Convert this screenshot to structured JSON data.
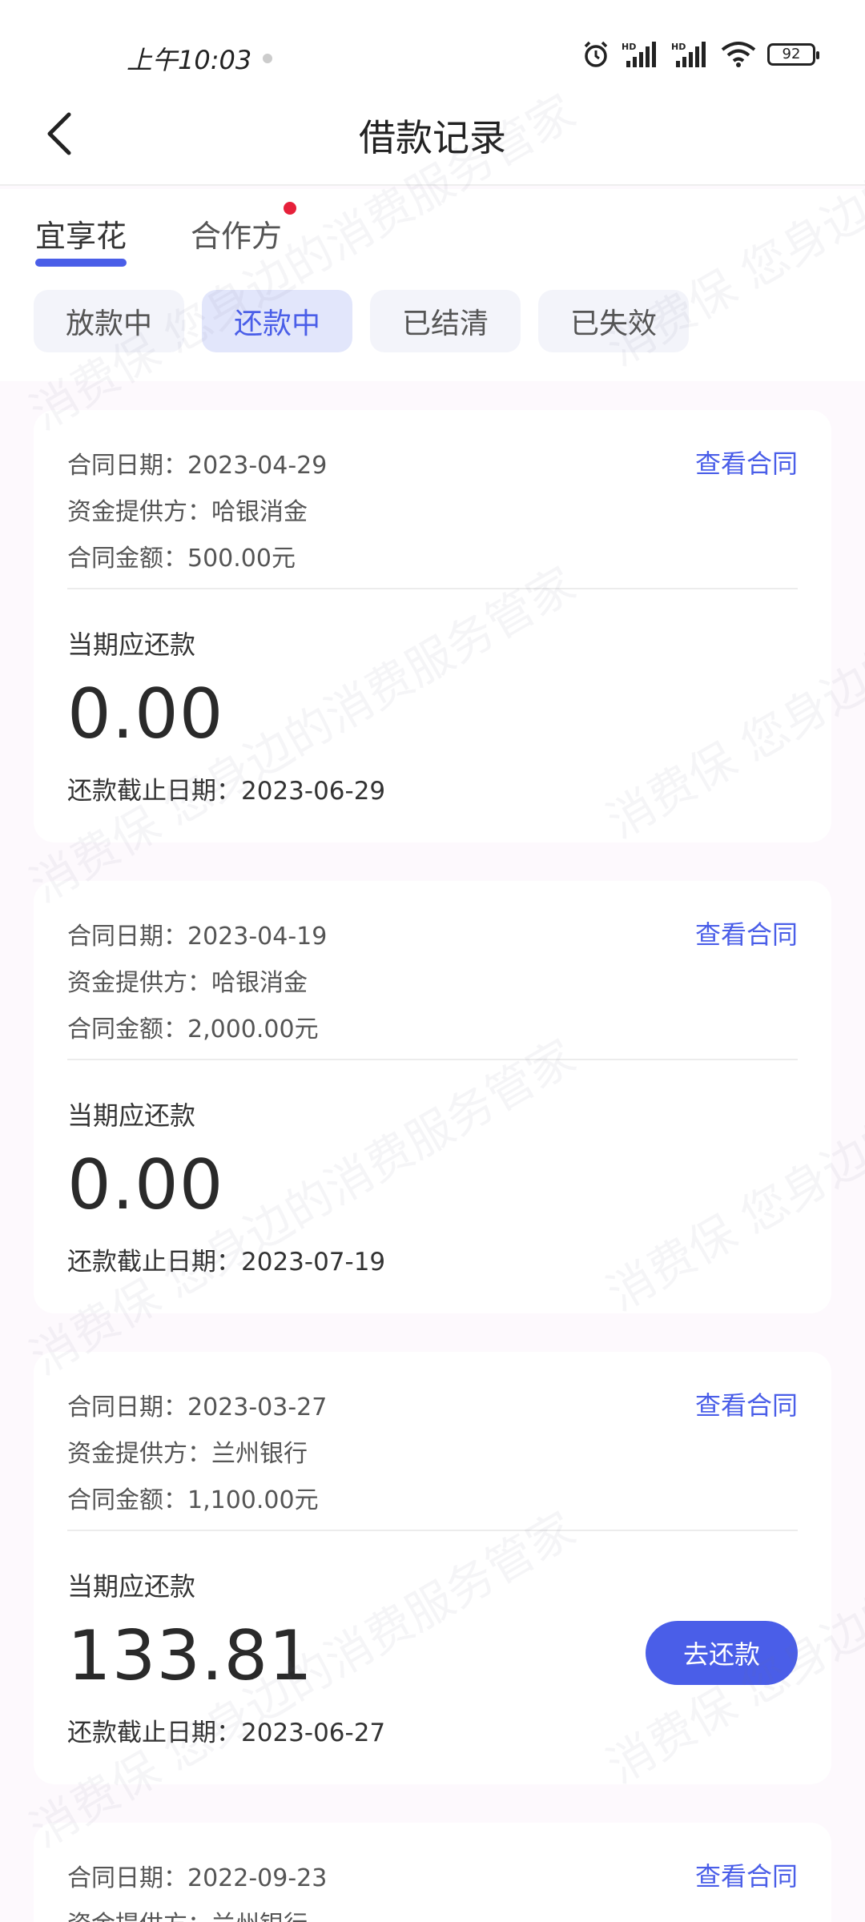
{
  "status_bar": {
    "time": "上午10:03",
    "battery": "92"
  },
  "nav": {
    "title": "借款记录"
  },
  "tabs": [
    {
      "label": "宜享花",
      "active": true
    },
    {
      "label": "合作方",
      "active": false,
      "badge": true
    }
  ],
  "filters": [
    {
      "label": "放款中",
      "active": false
    },
    {
      "label": "还款中",
      "active": true
    },
    {
      "label": "已结清",
      "active": false
    },
    {
      "label": "已失效",
      "active": false
    }
  ],
  "cards": [
    {
      "contract_date": "合同日期：2023-04-29",
      "provider": "资金提供方：哈银消金",
      "contract_amount": "合同金额：500.00元",
      "view_contract": "查看合同",
      "due_label": "当期应还款",
      "due_amount": "0.00",
      "deadline": "还款截止日期：2023-06-29"
    },
    {
      "contract_date": "合同日期：2023-04-19",
      "provider": "资金提供方：哈银消金",
      "contract_amount": "合同金额：2,000.00元",
      "view_contract": "查看合同",
      "due_label": "当期应还款",
      "due_amount": "0.00",
      "deadline": "还款截止日期：2023-07-19"
    },
    {
      "contract_date": "合同日期：2023-03-27",
      "provider": "资金提供方：兰州银行",
      "contract_amount": "合同金额：1,100.00元",
      "view_contract": "查看合同",
      "due_label": "当期应还款",
      "due_amount": "133.81",
      "deadline": "还款截止日期：2023-06-27",
      "repay_label": "去还款"
    },
    {
      "contract_date": "合同日期：2022-09-23",
      "provider": "资金提供方：兰州银行",
      "view_contract": "查看合同"
    }
  ],
  "watermark_text": "消费保 您身边的消费服务管家",
  "colors": {
    "accent": "#4a5ee8",
    "badge": "#e6203a",
    "chip_bg": "#f3f4fa",
    "chip_active_bg": "#e2e6fb"
  }
}
